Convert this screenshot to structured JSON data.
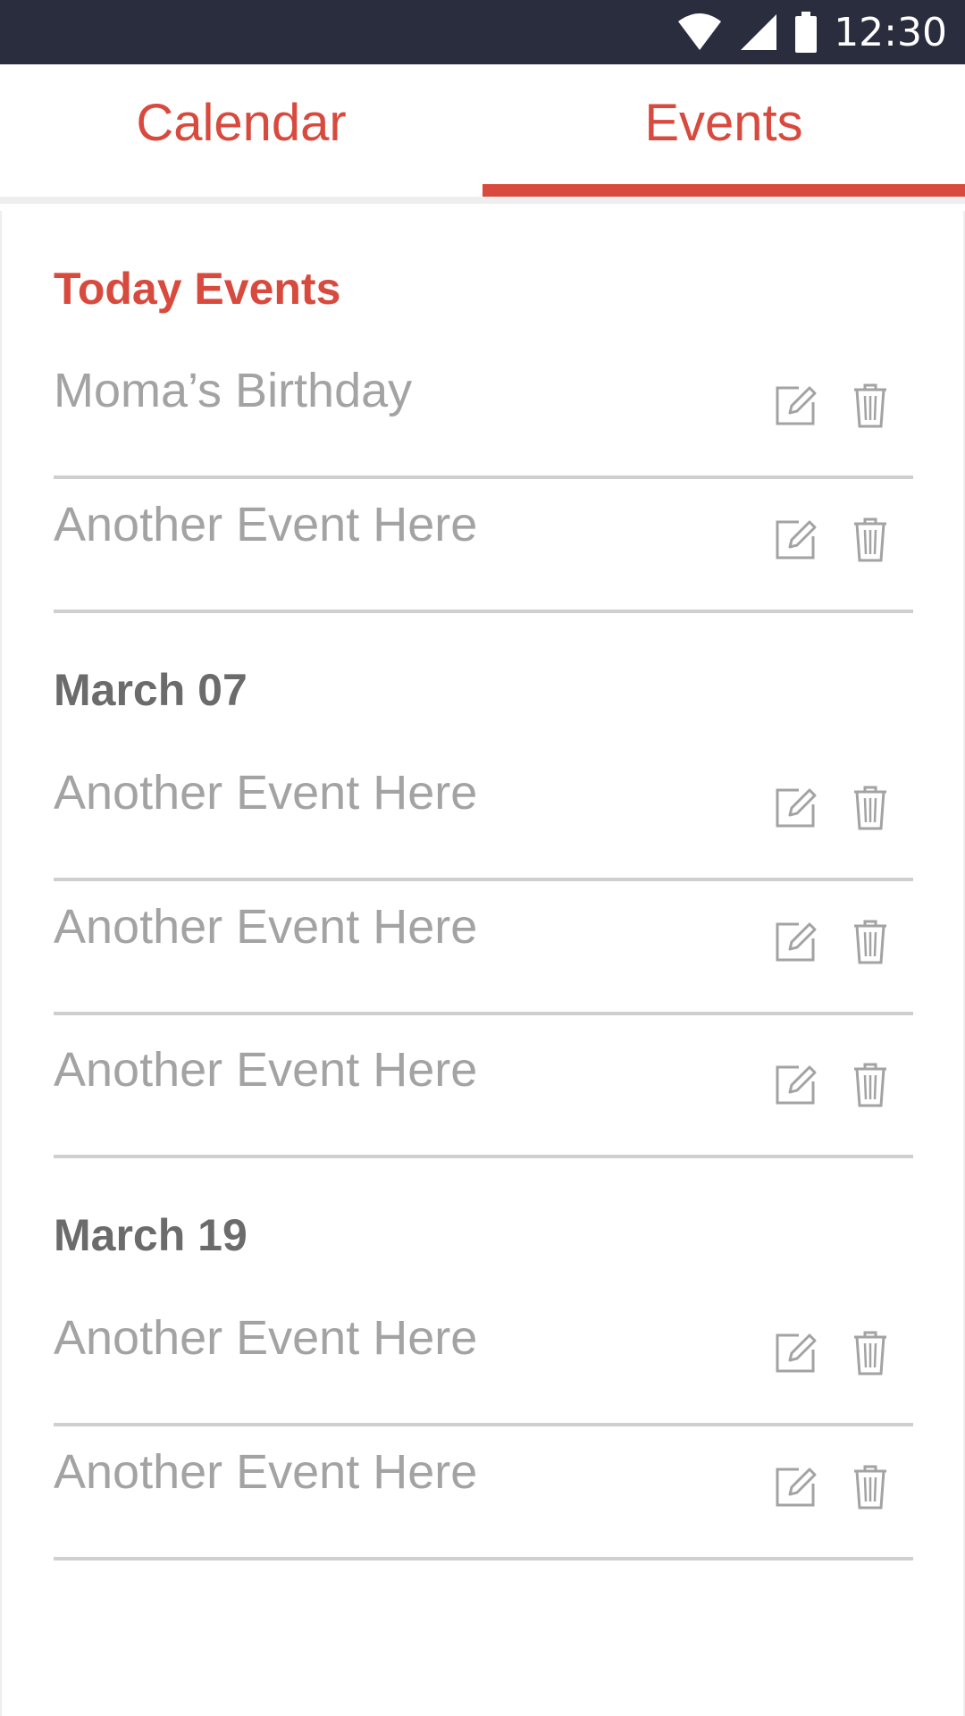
{
  "status_bar": {
    "time": "12:30",
    "icons": [
      "wifi-icon",
      "signal-icon",
      "battery-icon"
    ]
  },
  "tabs": [
    {
      "label": "Calendar",
      "active": false
    },
    {
      "label": "Events",
      "active": true
    }
  ],
  "sections": [
    {
      "title": "Today Events",
      "events": [
        "Moma’s Birthday",
        "Another Event Here"
      ]
    },
    {
      "title": "March 07",
      "events": [
        "Another Event Here",
        "Another Event Here",
        "Another Event Here"
      ]
    },
    {
      "title": "March 19",
      "events": [
        "Another Event Here",
        "Another Event Here"
      ]
    }
  ],
  "colors": {
    "accent": "#d84a3e",
    "status_bar": "#2a2d3d",
    "event_text": "#a3a3a3",
    "section_title": "#6b6b6b",
    "divider": "#cfcfcf",
    "icon": "#a3a3a3"
  },
  "row_icons": [
    "edit-icon",
    "trash-icon"
  ]
}
